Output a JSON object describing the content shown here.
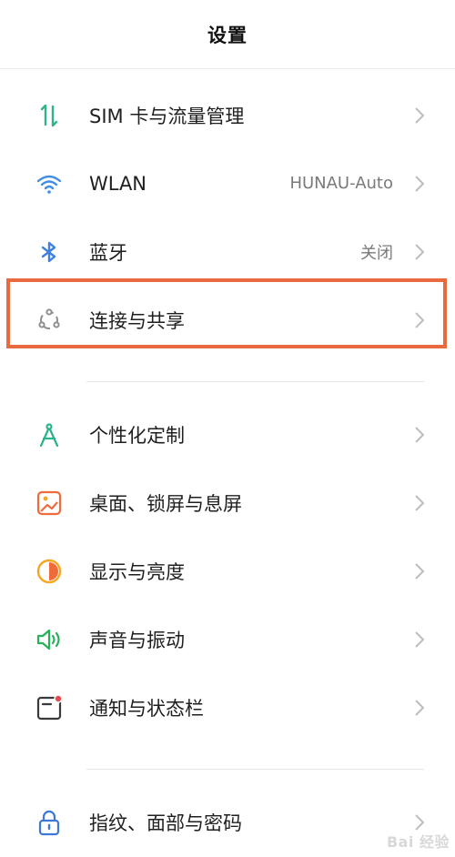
{
  "header": {
    "title": "设置"
  },
  "group1": [
    {
      "label": "SIM 卡与流量管理",
      "value": "",
      "icon": "sim-data-icon"
    },
    {
      "label": "WLAN",
      "value": "HUNAU-Auto",
      "icon": "wifi-icon"
    },
    {
      "label": "蓝牙",
      "value": "关闭",
      "icon": "bluetooth-icon"
    },
    {
      "label": "连接与共享",
      "value": "",
      "icon": "connection-share-icon"
    }
  ],
  "group2": [
    {
      "label": "个性化定制",
      "value": "",
      "icon": "personalize-icon"
    },
    {
      "label": "桌面、锁屏与息屏",
      "value": "",
      "icon": "wallpaper-icon"
    },
    {
      "label": "显示与亮度",
      "value": "",
      "icon": "display-brightness-icon"
    },
    {
      "label": "声音与振动",
      "value": "",
      "icon": "sound-icon"
    },
    {
      "label": "通知与状态栏",
      "value": "",
      "icon": "notification-icon"
    }
  ],
  "group3": [
    {
      "label": "指纹、面部与密码",
      "value": "",
      "icon": "lock-icon"
    }
  ],
  "watermark": "Bai 经验",
  "colors": {
    "highlight": "#e86a3e",
    "chevron": "#bdbdbd",
    "sim_green": "#2fb38a",
    "wifi_blue": "#3f8ee6",
    "bt_blue": "#3f7fe0",
    "share_gray": "#8e8e8e",
    "personal_green": "#29b38a",
    "wallpaper_orange": "#f06b3b",
    "display_orange": "#f5a623",
    "sound_green": "#27b15a",
    "notif_red": "#e84a4a",
    "lock_blue": "#3e78d6"
  }
}
